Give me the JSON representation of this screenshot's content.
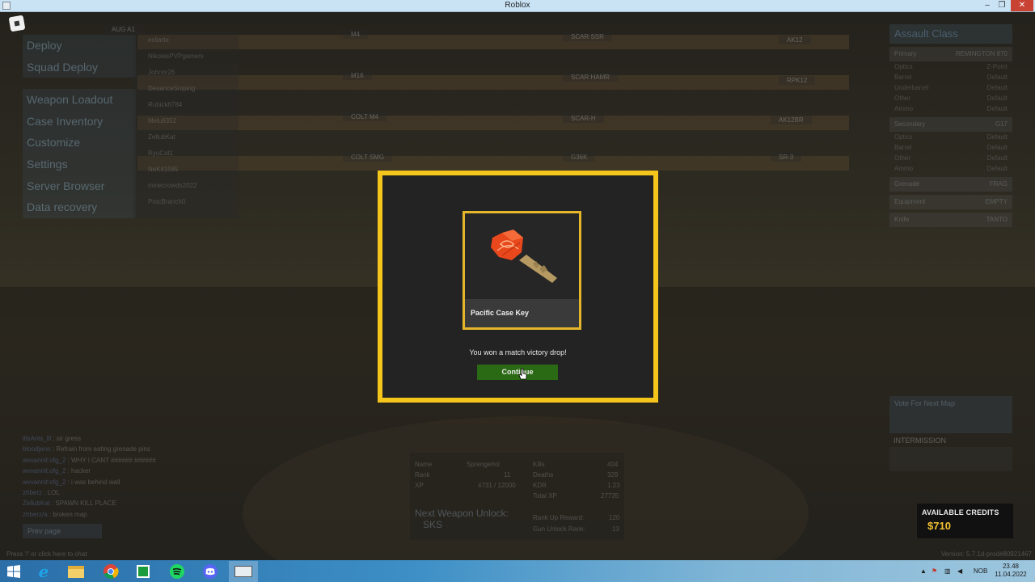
{
  "window": {
    "title": "Roblox",
    "min": "–",
    "max": "❐",
    "close": "✕"
  },
  "menu": {
    "items": [
      "Deploy",
      "Squad Deploy",
      "Weapon Loadout",
      "Case Inventory",
      "Customize",
      "Settings",
      "Server Browser",
      "Data recovery"
    ]
  },
  "players": [
    "ecliarte",
    "NikolasPVPgamers",
    "Johnnr26",
    "DesanceSniping",
    "Rubick6784",
    "Melu6352",
    "ZellubKat",
    "RyuCat1",
    "NeKit1585",
    "minecrowds2022",
    "PracBranch0"
  ],
  "weapons": [
    "AUG A1",
    "M4",
    "SCAR SSR",
    "AK12",
    "M16",
    "SCAR HAMR",
    "RPK12",
    "COLT M4",
    "SCAR-H",
    "AK12BR",
    "COLT SMG",
    "G36K",
    "SR-3"
  ],
  "right_panel": {
    "title": "Assault Class",
    "primary": {
      "label": "Primary",
      "value": "REMINGTON 870"
    },
    "primary_rows": [
      [
        "Optics",
        "Z-Point"
      ],
      [
        "Barrel",
        "Default"
      ],
      [
        "Underbarrel",
        "Default"
      ],
      [
        "Other",
        "Default"
      ],
      [
        "Ammo",
        "Default"
      ]
    ],
    "secondary": {
      "label": "Secondary",
      "value": "G17"
    },
    "secondary_rows": [
      [
        "Optics",
        "Default"
      ],
      [
        "Barrel",
        "Default"
      ],
      [
        "Other",
        "Default"
      ],
      [
        "Ammo",
        "Default"
      ]
    ],
    "grenade": {
      "label": "Grenade",
      "value": "FRAG"
    },
    "equipment": {
      "label": "Equipment",
      "value": "EMPTY"
    },
    "knife": {
      "label": "Knife",
      "value": "TANTO"
    }
  },
  "vote": {
    "title": "Vote For Next Map"
  },
  "intermission": "INTERMISSION",
  "chat": [
    {
      "name": "lllsAnts_lll",
      "text": "sir gress"
    },
    {
      "name": "bloodjenn",
      "text": "Refrain from eating grenade pins"
    },
    {
      "name": "wvvannit:ofg_2",
      "text": "WHY I CANT ###### ######"
    },
    {
      "name": "wvvannit:ofg_2",
      "text": "hacker"
    },
    {
      "name": "wvvannit:ofg_2",
      "text": "i was behind wall"
    },
    {
      "name": "zhberz",
      "text": "LOL"
    },
    {
      "name": "ZellubKat",
      "text": "SPAWN KILL PLACE"
    },
    {
      "name": "zhberz/a",
      "text": "broken map"
    }
  ],
  "prev_page": "Prev page",
  "hint": "Press '/' or click here to chat",
  "version": "Version: 5.7.1d-prod#80921467",
  "stats": {
    "name_label": "Name",
    "name_value": "Sprengerlol",
    "rank_label": "Rank",
    "rank_value": "11",
    "xp_label": "XP",
    "xp_value": "4731 / 12000",
    "kills_label": "Kills",
    "kills_value": "404",
    "deaths_label": "Deaths",
    "deaths_value": "329",
    "kdr_label": "KDR",
    "kdr_value": "1.23",
    "total_xp_label": "Total XP",
    "total_xp_value": "27735",
    "next_unlock_label": "Next Weapon Unlock:",
    "next_unlock_value": "SKS",
    "rank_reward_label": "Rank Up Reward:",
    "rank_reward_value": "120",
    "gun_unlock_label": "Gun Unlock Rank:",
    "gun_unlock_value": "13"
  },
  "credits": {
    "label": "AVAILABLE CREDITS",
    "amount": "$710"
  },
  "modal": {
    "item_name": "Pacific Case Key",
    "message": "You won a match victory drop!",
    "button": "Continue"
  },
  "tray": {
    "lang": "NOB",
    "time": "23.48",
    "date": "11.04.2022"
  },
  "colors": {
    "modal_border": "#f4c51b",
    "button": "#2b6a14",
    "credits": "#f2c230"
  }
}
